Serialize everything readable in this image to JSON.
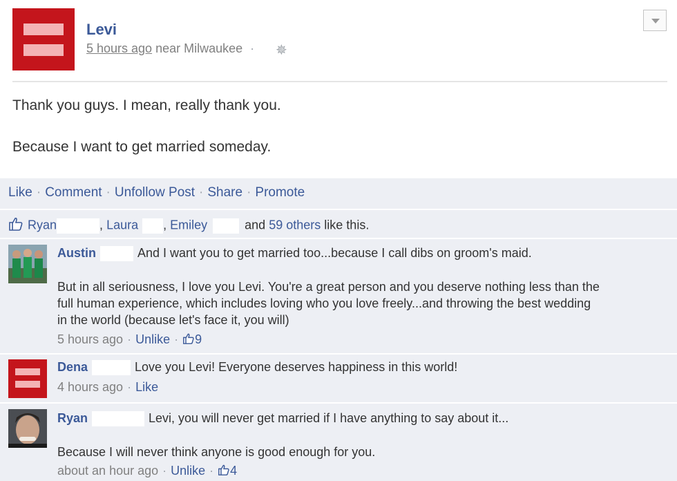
{
  "post": {
    "author": "Levi",
    "time": "5 hours ago",
    "location": "near Milwaukee",
    "menu_icon": "chevron-down-icon",
    "audience_icon": "gear-icon",
    "lines": [
      "Thank you guys. I mean, really thank you.",
      "Because I want to get married someday."
    ]
  },
  "actions": [
    "Like",
    "Comment",
    "Unfollow Post",
    "Share",
    "Promote"
  ],
  "likes": {
    "names": [
      "Ryan",
      "Laura",
      "Emiley"
    ],
    "comma": ",",
    "and": "and",
    "others": "59 others",
    "suffix": "like this."
  },
  "comments": [
    {
      "author": "Austin",
      "lines": [
        "And I want you to get married too...because I call dibs on groom's maid.",
        "But in all seriousness, I love you Levi. You're a great person and you deserve nothing less than the",
        "full human experience, which includes loving who you love freely...and throwing the best wedding",
        "in the world (because let's face it, you will)"
      ],
      "time": "5 hours ago",
      "action": "Unlike",
      "like_count": "9"
    },
    {
      "author": "Dena",
      "lines": [
        "Love you Levi! Everyone deserves happiness in this world!"
      ],
      "time": "4 hours ago",
      "action": "Like"
    },
    {
      "author": "Ryan",
      "lines": [
        "Levi, you will never get married if I have anything to say about it...",
        "Because I will never think anyone is good enough for you."
      ],
      "time": "about an hour ago",
      "action": "Unlike",
      "like_count": "4"
    }
  ],
  "colors": {
    "link": "#3b5998",
    "hrc_red": "#c4151c",
    "hrc_pink": "#f4b3b5",
    "footer_bg": "#edeff4"
  }
}
